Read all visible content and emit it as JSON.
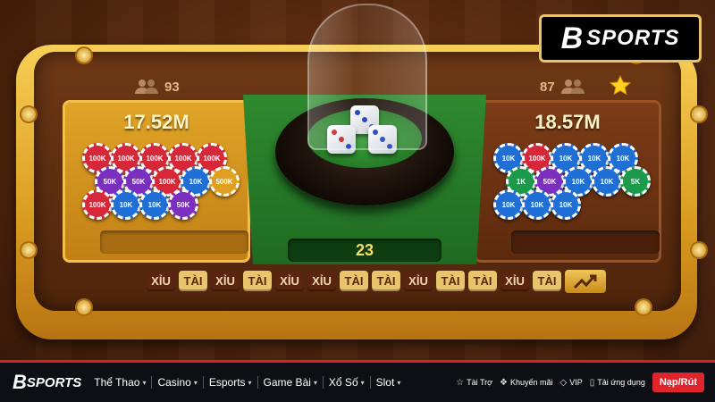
{
  "game": {
    "left_panel": {
      "amount": "17.52M",
      "players": "93"
    },
    "right_panel": {
      "amount": "18.57M",
      "players": "87"
    },
    "timer": "23",
    "dice": [
      3,
      3,
      3
    ],
    "left_chips": [
      "100K",
      "100K",
      "100K",
      "100K",
      "100K",
      "50K",
      "50K",
      "100K",
      "10K",
      "500K",
      "100K",
      "10K",
      "10K",
      "50K"
    ],
    "right_chips": [
      "10K",
      "100K",
      "10K",
      "10K",
      "10K",
      "1K",
      "50K",
      "10K",
      "10K",
      "5K",
      "10K",
      "10K",
      "10K"
    ],
    "history": [
      "XỈU",
      "TÀI",
      "XỈU",
      "TÀI",
      "XỈU",
      "XỈU",
      "TÀI",
      "TÀI",
      "XỈU",
      "TÀI",
      "TÀI",
      "XỈU",
      "TÀI"
    ],
    "trend_icon": "trend-chart-icon"
  },
  "logo": {
    "brand_b": "B",
    "brand_text": "SPORTS"
  },
  "nav": {
    "logo_b": "B",
    "logo_text": "SPORTS",
    "menu": [
      "Thể Thao",
      "Casino",
      "Esports",
      "Game Bài",
      "Xổ Số",
      "Slot"
    ],
    "utilities": [
      {
        "icon": "shield-icon",
        "label": "Tài Trợ"
      },
      {
        "icon": "tag-icon",
        "label": "Khuyến mãi"
      },
      {
        "icon": "diamond-icon",
        "label": "VIP"
      },
      {
        "icon": "phone-icon",
        "label": "Tải ứng dụng"
      }
    ],
    "cta": "Nạp/Rút"
  },
  "colors": {
    "brand_red": "#e0242c",
    "tai": "#e9c46d",
    "xiu": "#5a2410",
    "gold": "#f2c04a"
  }
}
